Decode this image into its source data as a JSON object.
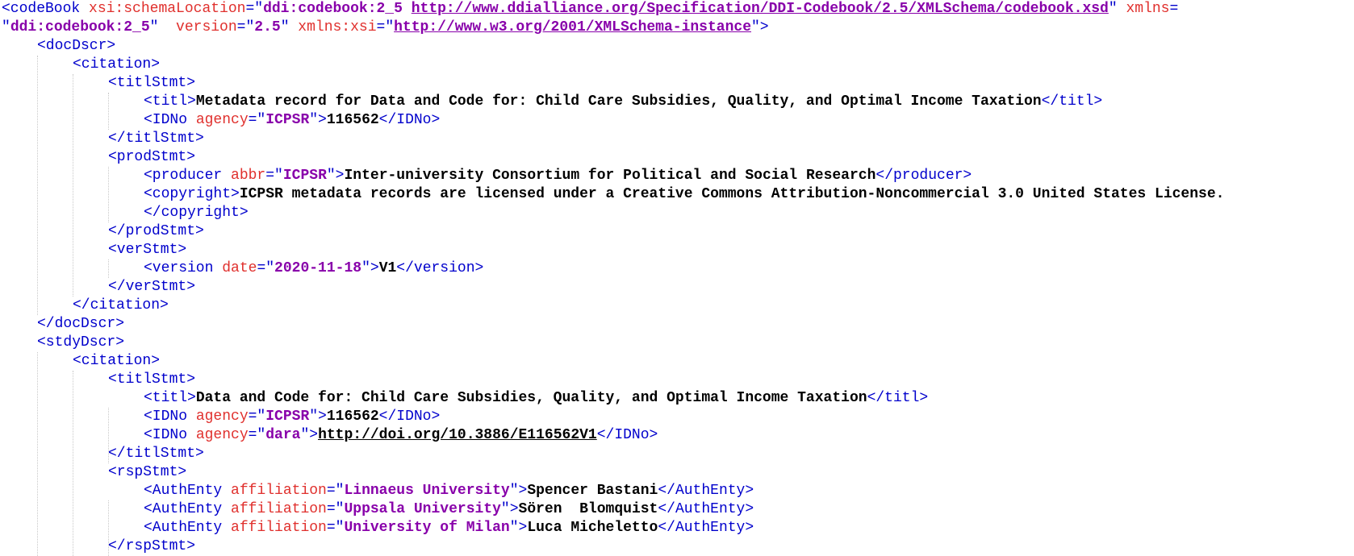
{
  "lines": [
    {
      "indent": 0,
      "parts": [
        [
          "t",
          "<codeBook "
        ],
        [
          "a",
          "xsi:schemaLocation"
        ],
        [
          "t",
          "=\""
        ],
        [
          "v",
          "ddi:codebook:2_5 "
        ],
        [
          "vu",
          "http://www.ddialliance.org/Specification/DDI-Codebook/2.5/XMLSchema/codebook.xsd"
        ],
        [
          "t",
          "\" "
        ],
        [
          "a",
          "xmlns"
        ],
        [
          "t",
          "="
        ]
      ]
    },
    {
      "indent": 0,
      "parts": [
        [
          "t",
          "\""
        ],
        [
          "v",
          "ddi:codebook:2_5"
        ],
        [
          "t",
          "\"  "
        ],
        [
          "a",
          "version"
        ],
        [
          "t",
          "=\""
        ],
        [
          "v",
          "2.5"
        ],
        [
          "t",
          "\" "
        ],
        [
          "a",
          "xmlns:xsi"
        ],
        [
          "t",
          "=\""
        ],
        [
          "vu",
          "http://www.w3.org/2001/XMLSchema-instance"
        ],
        [
          "t",
          "\">"
        ]
      ]
    },
    {
      "indent": 1,
      "parts": [
        [
          "t",
          "<docDscr>"
        ]
      ]
    },
    {
      "indent": 2,
      "parts": [
        [
          "t",
          "<citation>"
        ]
      ]
    },
    {
      "indent": 3,
      "parts": [
        [
          "t",
          "<titlStmt>"
        ]
      ]
    },
    {
      "indent": 4,
      "parts": [
        [
          "t",
          "<titl>"
        ],
        [
          "x",
          "Metadata record for Data and Code for: Child Care Subsidies, Quality, and Optimal Income Taxation"
        ],
        [
          "t",
          "</titl>"
        ]
      ]
    },
    {
      "indent": 4,
      "parts": [
        [
          "t",
          "<IDNo "
        ],
        [
          "a",
          "agency"
        ],
        [
          "t",
          "=\""
        ],
        [
          "v",
          "ICPSR"
        ],
        [
          "t",
          "\">"
        ],
        [
          "x",
          "116562"
        ],
        [
          "t",
          "</IDNo>"
        ]
      ]
    },
    {
      "indent": 3,
      "parts": [
        [
          "t",
          "</titlStmt>"
        ]
      ]
    },
    {
      "indent": 3,
      "parts": [
        [
          "t",
          "<prodStmt>"
        ]
      ]
    },
    {
      "indent": 4,
      "parts": [
        [
          "t",
          "<producer "
        ],
        [
          "a",
          "abbr"
        ],
        [
          "t",
          "=\""
        ],
        [
          "v",
          "ICPSR"
        ],
        [
          "t",
          "\">"
        ],
        [
          "x",
          "Inter-university Consortium for Political and Social Research"
        ],
        [
          "t",
          "</producer>"
        ]
      ]
    },
    {
      "indent": 4,
      "parts": [
        [
          "t",
          "<copyright>"
        ],
        [
          "x",
          "ICPSR metadata records are licensed under a Creative Commons Attribution-Noncommercial 3.0 United States License."
        ]
      ]
    },
    {
      "indent": 4,
      "parts": [
        [
          "t",
          "</copyright>"
        ]
      ]
    },
    {
      "indent": 3,
      "parts": [
        [
          "t",
          "</prodStmt>"
        ]
      ]
    },
    {
      "indent": 3,
      "parts": [
        [
          "t",
          "<verStmt>"
        ]
      ]
    },
    {
      "indent": 4,
      "parts": [
        [
          "t",
          "<version "
        ],
        [
          "a",
          "date"
        ],
        [
          "t",
          "=\""
        ],
        [
          "v",
          "2020-11-18"
        ],
        [
          "t",
          "\">"
        ],
        [
          "x",
          "V1"
        ],
        [
          "t",
          "</version>"
        ]
      ]
    },
    {
      "indent": 3,
      "parts": [
        [
          "t",
          "</verStmt>"
        ]
      ]
    },
    {
      "indent": 2,
      "parts": [
        [
          "t",
          "</citation>"
        ]
      ]
    },
    {
      "indent": 1,
      "parts": [
        [
          "t",
          "</docDscr>"
        ]
      ]
    },
    {
      "indent": 1,
      "parts": [
        [
          "t",
          "<stdyDscr>"
        ]
      ]
    },
    {
      "indent": 2,
      "parts": [
        [
          "t",
          "<citation>"
        ]
      ]
    },
    {
      "indent": 3,
      "parts": [
        [
          "t",
          "<titlStmt>"
        ]
      ]
    },
    {
      "indent": 4,
      "parts": [
        [
          "t",
          "<titl>"
        ],
        [
          "x",
          "Data and Code for: Child Care Subsidies, Quality, and Optimal Income Taxation"
        ],
        [
          "t",
          "</titl>"
        ]
      ]
    },
    {
      "indent": 4,
      "parts": [
        [
          "t",
          "<IDNo "
        ],
        [
          "a",
          "agency"
        ],
        [
          "t",
          "=\""
        ],
        [
          "v",
          "ICPSR"
        ],
        [
          "t",
          "\">"
        ],
        [
          "x",
          "116562"
        ],
        [
          "t",
          "</IDNo>"
        ]
      ]
    },
    {
      "indent": 4,
      "parts": [
        [
          "t",
          "<IDNo "
        ],
        [
          "a",
          "agency"
        ],
        [
          "t",
          "=\""
        ],
        [
          "v",
          "dara"
        ],
        [
          "t",
          "\">"
        ],
        [
          "xu",
          "http://doi.org/10.3886/E116562V1"
        ],
        [
          "t",
          "</IDNo>"
        ]
      ]
    },
    {
      "indent": 3,
      "parts": [
        [
          "t",
          "</titlStmt>"
        ]
      ]
    },
    {
      "indent": 3,
      "parts": [
        [
          "t",
          "<rspStmt>"
        ]
      ]
    },
    {
      "indent": 4,
      "parts": [
        [
          "t",
          "<AuthEnty "
        ],
        [
          "a",
          "affiliation"
        ],
        [
          "t",
          "=\""
        ],
        [
          "v",
          "Linnaeus University"
        ],
        [
          "t",
          "\">"
        ],
        [
          "x",
          "Spencer Bastani"
        ],
        [
          "t",
          "</AuthEnty>"
        ]
      ]
    },
    {
      "indent": 4,
      "parts": [
        [
          "t",
          "<AuthEnty "
        ],
        [
          "a",
          "affiliation"
        ],
        [
          "t",
          "=\""
        ],
        [
          "v",
          "Uppsala University"
        ],
        [
          "t",
          "\">"
        ],
        [
          "x",
          "Sören  Blomquist"
        ],
        [
          "t",
          "</AuthEnty>"
        ]
      ]
    },
    {
      "indent": 4,
      "parts": [
        [
          "t",
          "<AuthEnty "
        ],
        [
          "a",
          "affiliation"
        ],
        [
          "t",
          "=\""
        ],
        [
          "v",
          "University of Milan"
        ],
        [
          "t",
          "\">"
        ],
        [
          "x",
          "Luca Micheletto"
        ],
        [
          "t",
          "</AuthEnty>"
        ]
      ]
    },
    {
      "indent": 3,
      "parts": [
        [
          "t",
          "</rspStmt>"
        ]
      ]
    }
  ]
}
